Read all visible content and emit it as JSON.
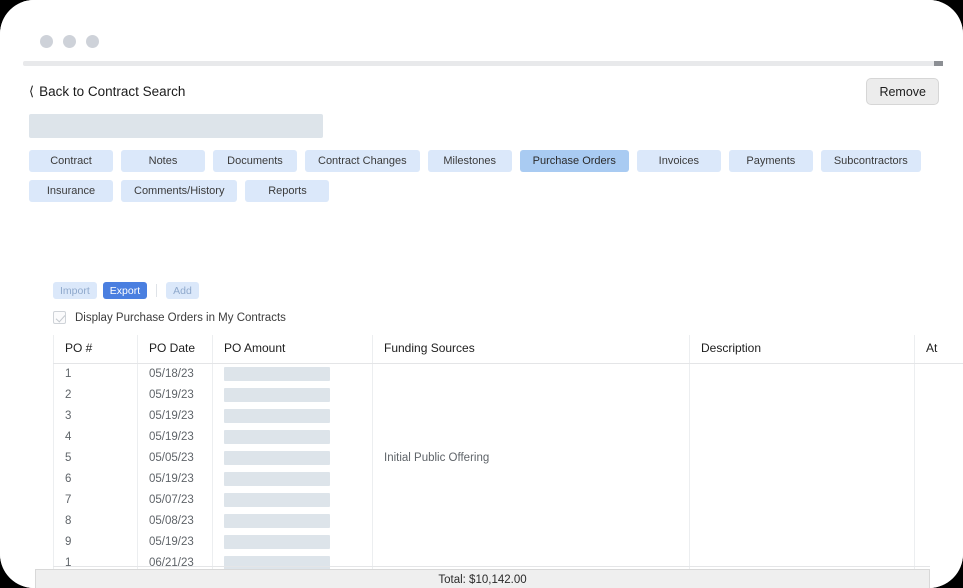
{
  "window": {
    "traffic_lights": [
      "close-dot",
      "minimize-dot",
      "maximize-dot"
    ]
  },
  "header": {
    "back_label": "Back to Contract Search",
    "back_chevron": "chevron-left-icon",
    "remove_label": "Remove",
    "redacted_title": ""
  },
  "tabs": [
    {
      "label": "Contract",
      "active": false
    },
    {
      "label": "Notes",
      "active": false
    },
    {
      "label": "Documents",
      "active": false
    },
    {
      "label": "Contract Changes",
      "active": false
    },
    {
      "label": "Milestones",
      "active": false
    },
    {
      "label": "Purchase Orders",
      "active": true
    },
    {
      "label": "Invoices",
      "active": false
    },
    {
      "label": "Payments",
      "active": false
    },
    {
      "label": "Subcontractors",
      "active": false
    },
    {
      "label": "Insurance",
      "active": false
    },
    {
      "label": "Comments/History",
      "active": false
    },
    {
      "label": "Reports",
      "active": false
    }
  ],
  "toolbar": {
    "import_label": "Import",
    "export_label": "Export",
    "add_label": "Add"
  },
  "options": {
    "display_po_label": "Display Purchase Orders in My Contracts",
    "display_po_checked": true
  },
  "table": {
    "columns": [
      "PO #",
      "PO Date",
      "PO Amount",
      "Funding Sources",
      "Description",
      "At"
    ],
    "rows": [
      {
        "po": "1",
        "date": "05/18/23",
        "amount": "",
        "funding": "",
        "description": "",
        "attachment": ""
      },
      {
        "po": "2",
        "date": "05/19/23",
        "amount": "",
        "funding": "",
        "description": "",
        "attachment": ""
      },
      {
        "po": "3",
        "date": "05/19/23",
        "amount": "",
        "funding": "",
        "description": "",
        "attachment": ""
      },
      {
        "po": "4",
        "date": "05/19/23",
        "amount": "",
        "funding": "",
        "description": "",
        "attachment": ""
      },
      {
        "po": "5",
        "date": "05/05/23",
        "amount": "",
        "funding": "Initial Public Offering",
        "description": "",
        "attachment": ""
      },
      {
        "po": "6",
        "date": "05/19/23",
        "amount": "",
        "funding": "",
        "description": "",
        "attachment": ""
      },
      {
        "po": "7",
        "date": "05/07/23",
        "amount": "",
        "funding": "",
        "description": "",
        "attachment": ""
      },
      {
        "po": "8",
        "date": "05/08/23",
        "amount": "",
        "funding": "",
        "description": "",
        "attachment": ""
      },
      {
        "po": "9",
        "date": "05/19/23",
        "amount": "",
        "funding": "",
        "description": "",
        "attachment": ""
      },
      {
        "po": "1",
        "date": "06/21/23",
        "amount": "",
        "funding": "",
        "description": "",
        "attachment": ""
      }
    ],
    "total_label": "Total: $10,142.00"
  },
  "colors": {
    "tab_bg": "#dbe8fa",
    "tab_active_bg": "#a9cbf2",
    "button_hover_bg": "#4a7fe0",
    "redaction": "#dde4ea",
    "total_bg": "#efefef"
  }
}
